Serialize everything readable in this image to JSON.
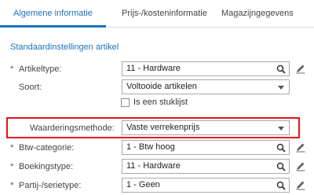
{
  "tabs": [
    {
      "label": "Algemene informatie"
    },
    {
      "label": "Prijs-/kosteninformatie"
    },
    {
      "label": "Magazijngegevens"
    }
  ],
  "section_title": "Standaardinstellingen artikel",
  "fields": {
    "artikeltype": {
      "required": "*",
      "label": "Artikeltype:",
      "value": "11 - Hardware",
      "icon": "search-icon"
    },
    "soort": {
      "label": "Soort:",
      "value": "Voltooide artikelen",
      "icon": "chevron-down-icon"
    },
    "stuklijst": {
      "label": "Is een stuklijst",
      "checked": false
    },
    "waarderingsmethode": {
      "label": "Waarderingsmethode:",
      "value": "Vaste verrekenprijs",
      "icon": "chevron-down-icon",
      "highlight_color": "#e3141b"
    },
    "btw_categorie": {
      "required": "*",
      "label": "Btw-categorie:",
      "value": "1 - Btw hoog",
      "icon": "search-icon"
    },
    "boekingstype": {
      "required": "*",
      "label": "Boekingstype:",
      "value": "11 - Hardware",
      "icon": "search-icon"
    },
    "partij_serietype": {
      "required": "*",
      "label": "Partij-/serietype:",
      "value": "1 - Geen",
      "icon": "search-icon"
    }
  },
  "colors": {
    "accent": "#1f72b8",
    "highlight": "#e3141b"
  }
}
